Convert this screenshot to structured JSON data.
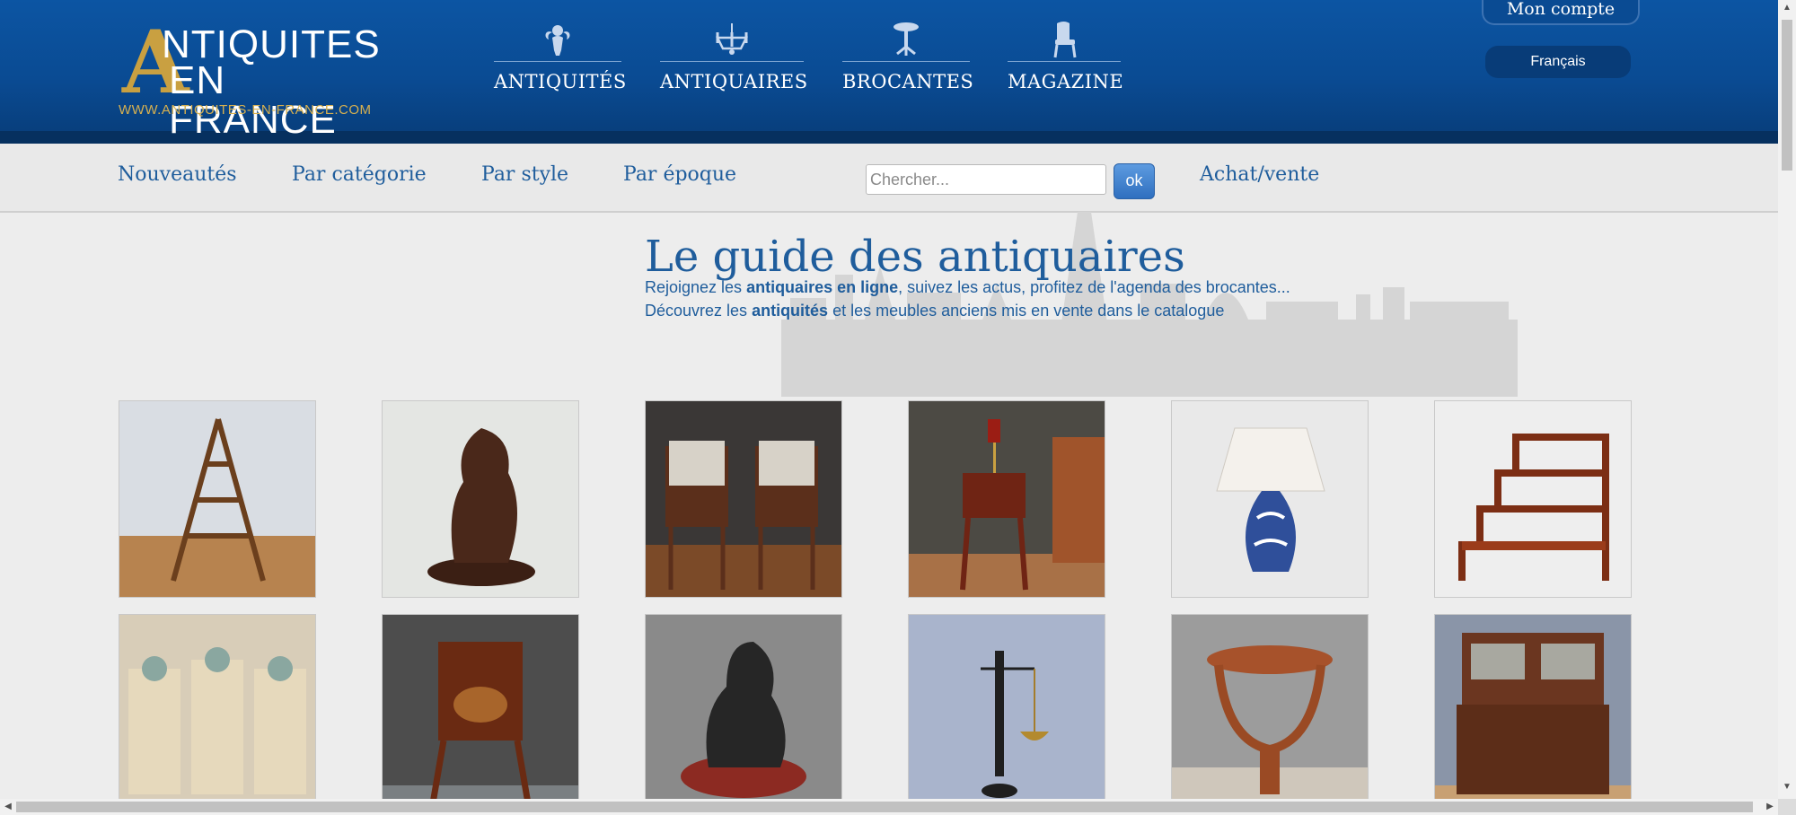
{
  "logo": {
    "initial": "A",
    "line1": "NTIQUITES",
    "line2": "EN FRANCE",
    "url": "WWW.ANTIQUITES-EN-FRANCE.COM"
  },
  "main_nav": [
    {
      "label": "ANTIQUITÉS",
      "icon": "cherub-icon"
    },
    {
      "label": "ANTIQUAIRES",
      "icon": "chandelier-icon"
    },
    {
      "label": "BROCANTES",
      "icon": "pedestal-table-icon"
    },
    {
      "label": "MAGAZINE",
      "icon": "chair-icon"
    }
  ],
  "account": {
    "label": "Mon compte"
  },
  "language": {
    "label": "Français"
  },
  "subnav": {
    "new": "Nouveautés",
    "category": "Par catégorie",
    "style": "Par style",
    "era": "Par époque",
    "buy_sell": "Achat/vente"
  },
  "search": {
    "placeholder": "Chercher...",
    "value": "",
    "button": "ok"
  },
  "hero": {
    "title": "Le guide des antiquaires",
    "line1_pre": "Rejoignez les ",
    "line1_bold": "antiquaires en ligne",
    "line1_post": ", suivez les actus, profitez de l'agenda des brocantes...",
    "line2_pre": "Découvrez les ",
    "line2_bold": "antiquités",
    "line2_post": " et les meubles anciens mis en vente dans le catalogue"
  },
  "products": [
    {
      "subject": "library-step-ladder"
    },
    {
      "subject": "bronze-sculpture-figure"
    },
    {
      "subject": "pair-marble-bedside-tables"
    },
    {
      "subject": "mahogany-side-table-lamp"
    },
    {
      "subject": "blue-white-porcelain-lamp"
    },
    {
      "subject": "mahogany-library-steps"
    },
    {
      "subject": "painted-wall-panels"
    },
    {
      "subject": "marquetry-writing-desk"
    },
    {
      "subject": "bronze-sculpture-seated-man"
    },
    {
      "subject": "bronze-justice-figure"
    },
    {
      "subject": "art-deco-pedestal-table"
    },
    {
      "subject": "oak-dresser-buffet"
    }
  ],
  "colors": {
    "header_blue": "#0a4b93",
    "link_blue": "#1f5d9c",
    "logo_gold": "#c9a041"
  }
}
